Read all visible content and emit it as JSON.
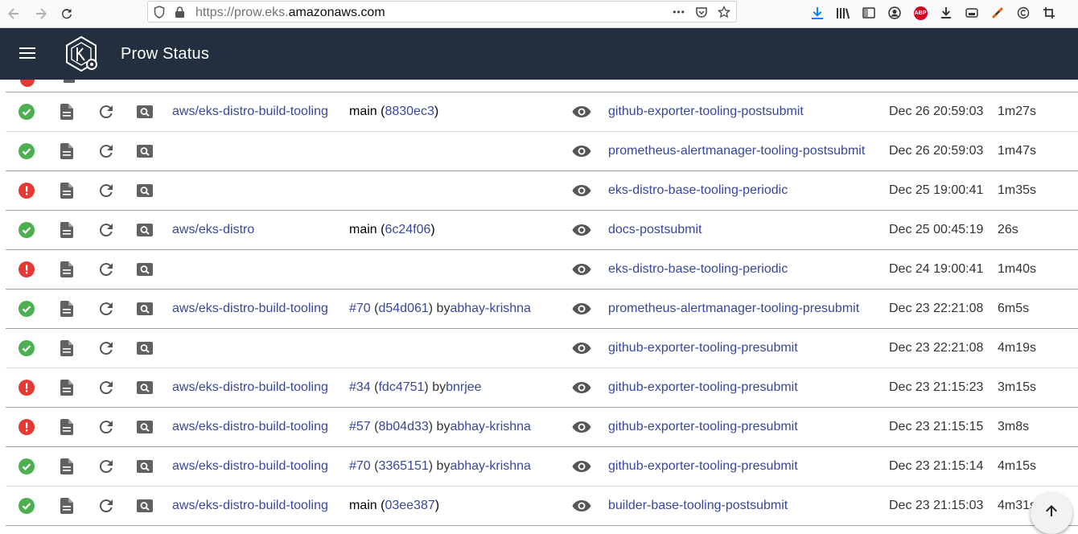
{
  "browser": {
    "url_prefix": "https://prow.eks.",
    "url_domain": "amazonaws.com",
    "page_actions_label": "•••"
  },
  "app": {
    "title": "Prow Status",
    "header_color": "#232f3e",
    "link_color": "#37479b",
    "success_color": "#4caf50",
    "failure_color": "#e53935"
  },
  "jobs": [
    {
      "status": "success",
      "repo": "aws/eks-distro-build-tooling",
      "ref_prefix": "main (",
      "pr": "",
      "sha": "8830ec3",
      "ref_suffix": ")",
      "author_sep": "",
      "author": "",
      "job": "github-exporter-tooling-postsubmit",
      "started": "Dec 26 20:59:03",
      "duration": "1m27s"
    },
    {
      "status": "success",
      "repo": "",
      "ref_prefix": "",
      "pr": "",
      "sha": "",
      "ref_suffix": "",
      "author_sep": "",
      "author": "",
      "job": "prometheus-alertmanager-tooling-postsubmit",
      "started": "Dec 26 20:59:03",
      "duration": "1m47s"
    },
    {
      "status": "failure",
      "repo": "",
      "ref_prefix": "",
      "pr": "",
      "sha": "",
      "ref_suffix": "",
      "author_sep": "",
      "author": "",
      "job": "eks-distro-base-tooling-periodic",
      "started": "Dec 25 19:00:41",
      "duration": "1m35s"
    },
    {
      "status": "success",
      "repo": "aws/eks-distro",
      "ref_prefix": "main (",
      "pr": "",
      "sha": "6c24f06",
      "ref_suffix": ")",
      "author_sep": "",
      "author": "",
      "job": "docs-postsubmit",
      "started": "Dec 25 00:45:19",
      "duration": "26s"
    },
    {
      "status": "failure",
      "repo": "",
      "ref_prefix": "",
      "pr": "",
      "sha": "",
      "ref_suffix": "",
      "author_sep": "",
      "author": "",
      "job": "eks-distro-base-tooling-periodic",
      "started": "Dec 24 19:00:41",
      "duration": "1m40s"
    },
    {
      "status": "success",
      "repo": "aws/eks-distro-build-tooling",
      "ref_prefix": "",
      "pr": "#70",
      "sha": "d54d061",
      "ref_suffix": ")",
      "author_sep": ") by ",
      "author": "abhay-krishna",
      "job": "prometheus-alertmanager-tooling-presubmit",
      "started": "Dec 23 22:21:08",
      "duration": "6m5s"
    },
    {
      "status": "success",
      "repo": "",
      "ref_prefix": "",
      "pr": "",
      "sha": "",
      "ref_suffix": "",
      "author_sep": "",
      "author": "",
      "job": "github-exporter-tooling-presubmit",
      "started": "Dec 23 22:21:08",
      "duration": "4m19s"
    },
    {
      "status": "failure",
      "repo": "aws/eks-distro-build-tooling",
      "ref_prefix": "",
      "pr": "#34",
      "sha": "fdc4751",
      "ref_suffix": ")",
      "author_sep": ") by ",
      "author": "bnrjee",
      "job": "github-exporter-tooling-presubmit",
      "started": "Dec 23 21:15:23",
      "duration": "3m15s"
    },
    {
      "status": "failure",
      "repo": "aws/eks-distro-build-tooling",
      "ref_prefix": "",
      "pr": "#57",
      "sha": "8b04d33",
      "ref_suffix": ")",
      "author_sep": ") by ",
      "author": "abhay-krishna",
      "job": "github-exporter-tooling-presubmit",
      "started": "Dec 23 21:15:15",
      "duration": "3m8s"
    },
    {
      "status": "success",
      "repo": "aws/eks-distro-build-tooling",
      "ref_prefix": "",
      "pr": "#70",
      "sha": "3365151",
      "ref_suffix": ")",
      "author_sep": ") by ",
      "author": "abhay-krishna",
      "job": "github-exporter-tooling-presubmit",
      "started": "Dec 23 21:15:14",
      "duration": "4m15s"
    },
    {
      "status": "success",
      "repo": "aws/eks-distro-build-tooling",
      "ref_prefix": "main (",
      "pr": "",
      "sha": "03ee387",
      "ref_suffix": ")",
      "author_sep": "",
      "author": "",
      "job": "builder-base-tooling-postsubmit",
      "started": "Dec 23 21:15:03",
      "duration": "4m31s"
    }
  ]
}
